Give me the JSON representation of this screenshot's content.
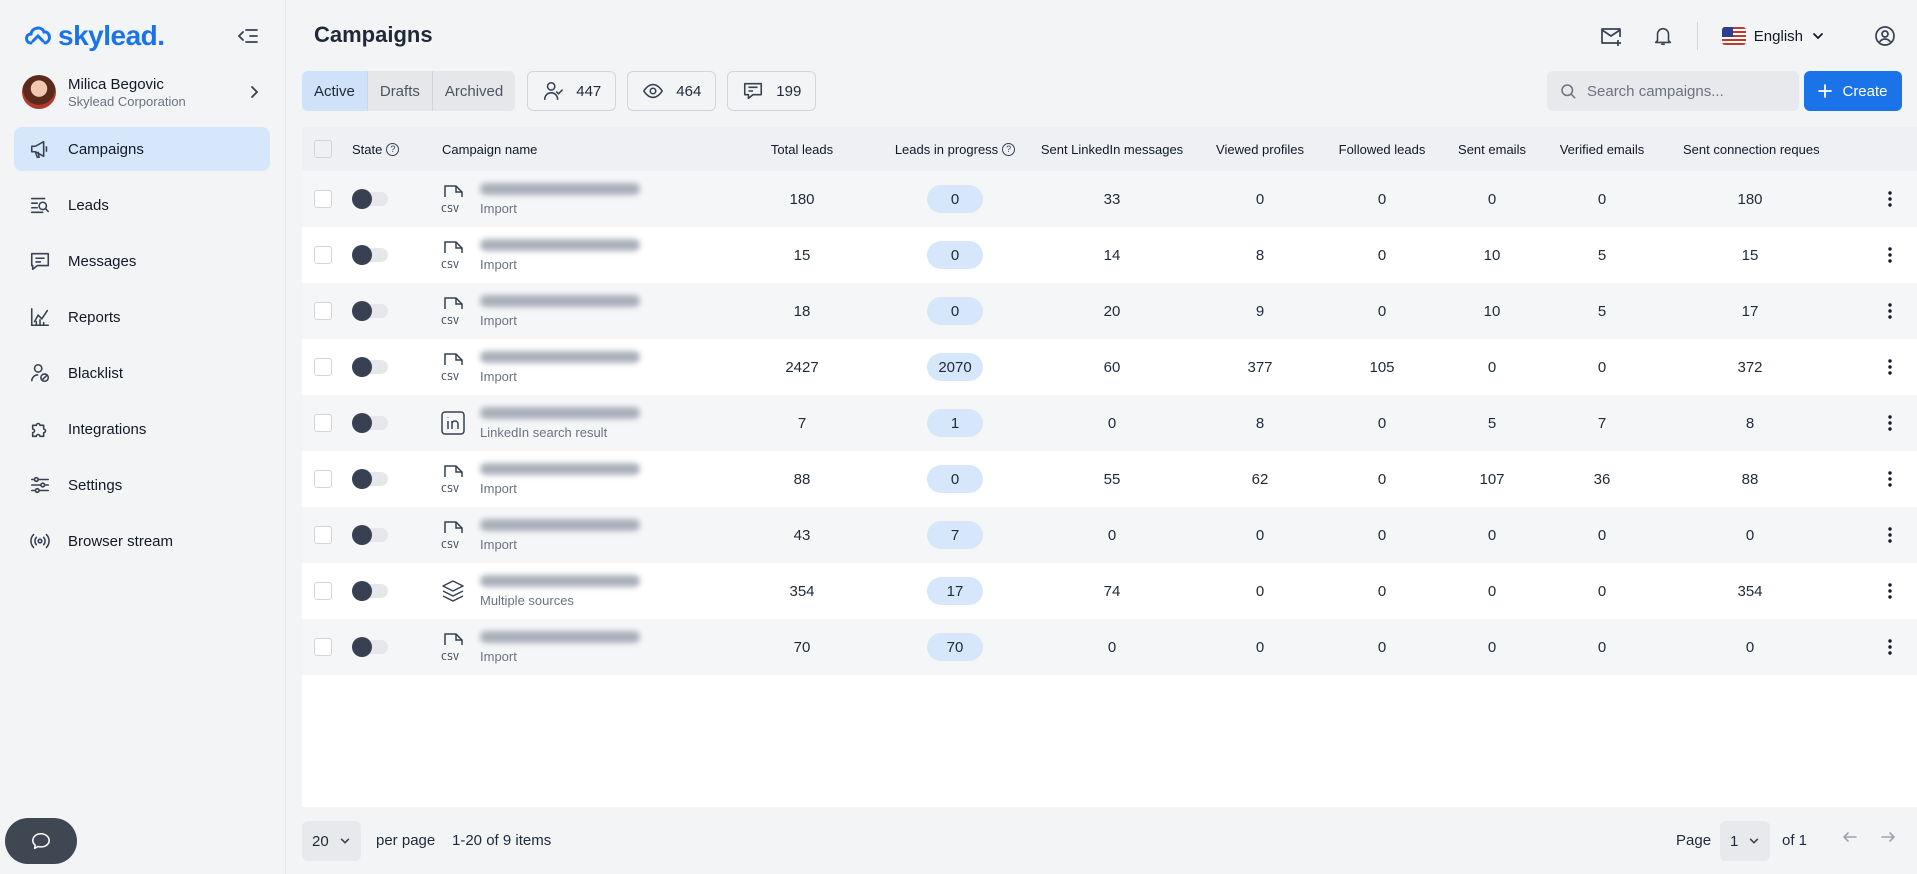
{
  "app": {
    "logo_text": "skylead."
  },
  "profile": {
    "name": "Milica Begovic",
    "org": "Skylead Corporation"
  },
  "nav": [
    {
      "label": "Campaigns",
      "icon": "megaphone-icon",
      "active": true
    },
    {
      "label": "Leads",
      "icon": "leads-search-icon"
    },
    {
      "label": "Messages",
      "icon": "message-icon"
    },
    {
      "label": "Reports",
      "icon": "chart-icon"
    },
    {
      "label": "Blacklist",
      "icon": "user-block-icon"
    },
    {
      "label": "Integrations",
      "icon": "puzzle-icon"
    },
    {
      "label": "Settings",
      "icon": "sliders-icon"
    },
    {
      "label": "Browser stream",
      "icon": "broadcast-icon"
    }
  ],
  "header": {
    "title": "Campaigns",
    "language": "English"
  },
  "tabs": [
    {
      "label": "Active",
      "active": true
    },
    {
      "label": "Drafts"
    },
    {
      "label": "Archived"
    }
  ],
  "stats": {
    "leads": "447",
    "views": "464",
    "messages": "199"
  },
  "search": {
    "placeholder": "Search campaigns..."
  },
  "create_label": "Create",
  "columns": {
    "state": "State",
    "name": "Campaign name",
    "total_leads": "Total leads",
    "in_progress": "Leads in progress",
    "sent_linkedin": "Sent LinkedIn messages",
    "viewed": "Viewed profiles",
    "followed": "Followed leads",
    "sent_emails": "Sent emails",
    "verified": "Verified emails",
    "sent_conn": "Sent connection reques"
  },
  "rows": [
    {
      "icon": "csv-file-icon",
      "source": "Import",
      "total": "180",
      "progress": "0",
      "linkedin": "33",
      "viewed": "0",
      "followed": "0",
      "emails": "0",
      "verified": "0",
      "conn": "180"
    },
    {
      "icon": "csv-file-icon",
      "source": "Import",
      "total": "15",
      "progress": "0",
      "linkedin": "14",
      "viewed": "8",
      "followed": "0",
      "emails": "10",
      "verified": "5",
      "conn": "15"
    },
    {
      "icon": "csv-file-icon",
      "source": "Import",
      "total": "18",
      "progress": "0",
      "linkedin": "20",
      "viewed": "9",
      "followed": "0",
      "emails": "10",
      "verified": "5",
      "conn": "17"
    },
    {
      "icon": "csv-file-icon",
      "source": "Import",
      "total": "2427",
      "progress": "2070",
      "linkedin": "60",
      "viewed": "377",
      "followed": "105",
      "emails": "0",
      "verified": "0",
      "conn": "372"
    },
    {
      "icon": "linkedin-icon",
      "source": "LinkedIn search result",
      "total": "7",
      "progress": "1",
      "linkedin": "0",
      "viewed": "8",
      "followed": "0",
      "emails": "5",
      "verified": "7",
      "conn": "8"
    },
    {
      "icon": "csv-file-icon",
      "source": "Import",
      "total": "88",
      "progress": "0",
      "linkedin": "55",
      "viewed": "62",
      "followed": "0",
      "emails": "107",
      "verified": "36",
      "conn": "88"
    },
    {
      "icon": "csv-file-icon",
      "source": "Import",
      "total": "43",
      "progress": "7",
      "linkedin": "0",
      "viewed": "0",
      "followed": "0",
      "emails": "0",
      "verified": "0",
      "conn": "0"
    },
    {
      "icon": "layers-icon",
      "source": "Multiple sources",
      "total": "354",
      "progress": "17",
      "linkedin": "74",
      "viewed": "0",
      "followed": "0",
      "emails": "0",
      "verified": "0",
      "conn": "354"
    },
    {
      "icon": "csv-file-icon",
      "source": "Import",
      "total": "70",
      "progress": "70",
      "linkedin": "0",
      "viewed": "0",
      "followed": "0",
      "emails": "0",
      "verified": "0",
      "conn": "0"
    }
  ],
  "footer": {
    "per_page": "20",
    "per_page_label": "per page",
    "items_info": "1-20 of 9 items",
    "page_label": "Page",
    "page": "1",
    "of_label": "of 1"
  },
  "colors": {
    "accent": "#1a73e8",
    "active_bg": "#d6e6fb"
  }
}
